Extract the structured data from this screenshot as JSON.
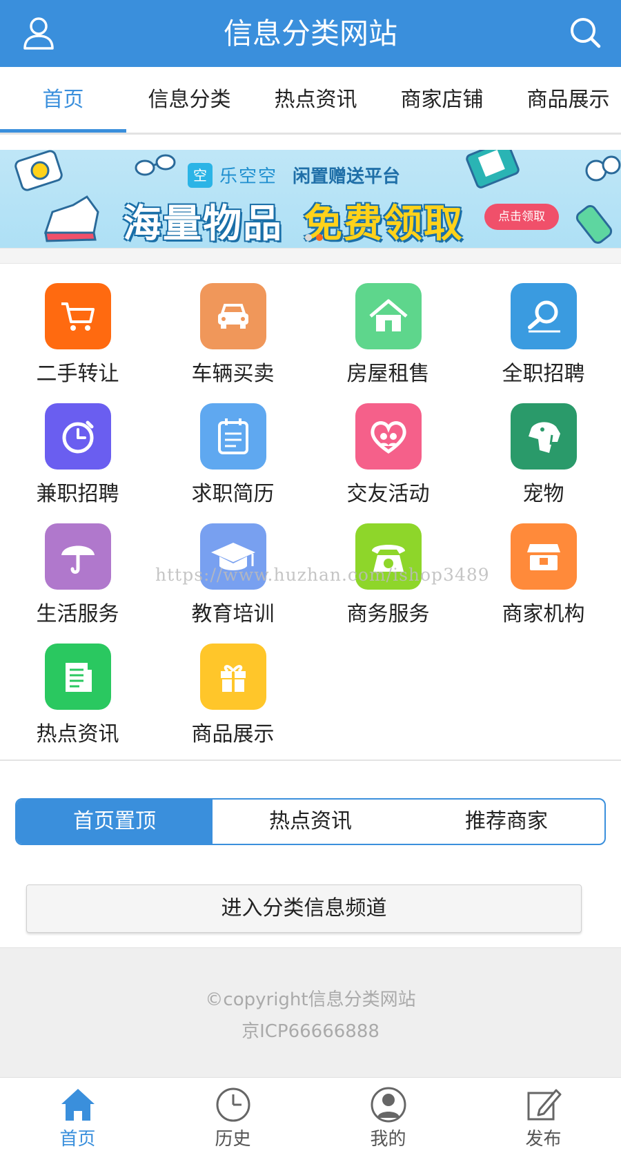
{
  "header": {
    "title": "信息分类网站",
    "user_icon": "user-icon",
    "search_icon": "search-icon"
  },
  "nav": {
    "tabs": [
      {
        "label": "首页",
        "active": true
      },
      {
        "label": "信息分类",
        "active": false
      },
      {
        "label": "热点资讯",
        "active": false
      },
      {
        "label": "商家店铺",
        "active": false
      },
      {
        "label": "商品展示",
        "active": false
      }
    ]
  },
  "banner": {
    "brand_logo": "空",
    "brand_name": "乐空空",
    "brand_slogan": "闲置赠送平台",
    "headline_a": "海量物品",
    "headline_b": "免费领取",
    "cta": "点击领取",
    "active_dot": 2
  },
  "categories": [
    {
      "label": "二手转让",
      "icon": "cart-icon",
      "color": "#ff6a10"
    },
    {
      "label": "车辆买卖",
      "icon": "car-icon",
      "color": "#f0975a"
    },
    {
      "label": "房屋租售",
      "icon": "house-icon",
      "color": "#5ed68c"
    },
    {
      "label": "全职招聘",
      "icon": "magnifier-icon",
      "color": "#3a9be0"
    },
    {
      "label": "兼职招聘",
      "icon": "stopwatch-icon",
      "color": "#6a5ef0"
    },
    {
      "label": "求职简历",
      "icon": "calendar-doc-icon",
      "color": "#5fa8f0"
    },
    {
      "label": "交友活动",
      "icon": "heart-couple-icon",
      "color": "#f5608a"
    },
    {
      "label": "宠物",
      "icon": "dog-icon",
      "color": "#2a9a6a"
    },
    {
      "label": "生活服务",
      "icon": "umbrella-icon",
      "color": "#b078cc"
    },
    {
      "label": "教育培训",
      "icon": "graduation-cap-icon",
      "color": "#78a0f0"
    },
    {
      "label": "商务服务",
      "icon": "telephone-icon",
      "color": "#8ed62a"
    },
    {
      "label": "商家机构",
      "icon": "shop-icon",
      "color": "#ff8a3a"
    },
    {
      "label": "热点资讯",
      "icon": "newspaper-icon",
      "color": "#2ac860"
    },
    {
      "label": "商品展示",
      "icon": "gift-icon",
      "color": "#ffc62a"
    }
  ],
  "watermark": "https://www.huzhan.com/ishop3489",
  "segment": {
    "tabs": [
      {
        "label": "首页置顶",
        "active": true
      },
      {
        "label": "热点资讯",
        "active": false
      },
      {
        "label": "推荐商家",
        "active": false
      }
    ]
  },
  "channel_button": "进入分类信息频道",
  "footer": {
    "copyright": "©copyright信息分类网站",
    "icp": "京ICP66666888"
  },
  "tabbar": [
    {
      "label": "首页",
      "icon": "home-icon",
      "active": true
    },
    {
      "label": "历史",
      "icon": "clock-icon",
      "active": false
    },
    {
      "label": "我的",
      "icon": "profile-icon",
      "active": false
    },
    {
      "label": "发布",
      "icon": "edit-icon",
      "active": false
    }
  ],
  "colors": {
    "primary": "#3a8fdc",
    "footer_bg": "#efefef"
  }
}
